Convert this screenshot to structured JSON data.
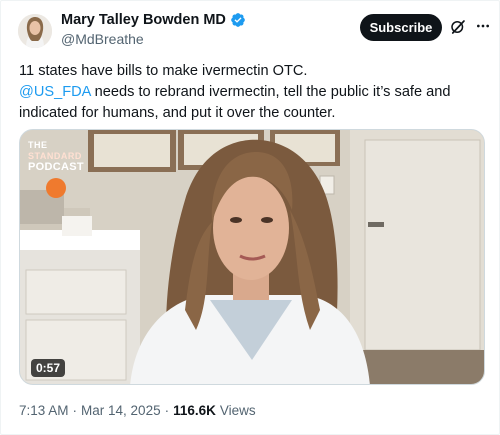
{
  "author": {
    "name": "Mary Talley Bowden MD",
    "handle": "@MdBreathe"
  },
  "actions": {
    "subscribe_label": "Subscribe",
    "grok_icon": "grok-icon",
    "more_icon": "more-icon"
  },
  "tweet": {
    "line1": "11 states have bills to make ivermectin OTC.",
    "mention": "@US_FDA",
    "line2_rest": " needs to rebrand ivermectin, tell the public it’s safe and indicated for humans, and put it over the counter."
  },
  "video": {
    "duration": "0:57",
    "logo_line1": "THE",
    "logo_line2": "STANDARD",
    "logo_line3": "PODCAST"
  },
  "meta": {
    "time": "7:13 AM",
    "date": "Mar 14, 2025",
    "separator": "·",
    "views_count": "116.6K",
    "views_label": "Views"
  },
  "colors": {
    "accent": "#1d9bf0",
    "text": "#0f1419",
    "muted": "#536471",
    "button_bg": "#0f1419"
  }
}
